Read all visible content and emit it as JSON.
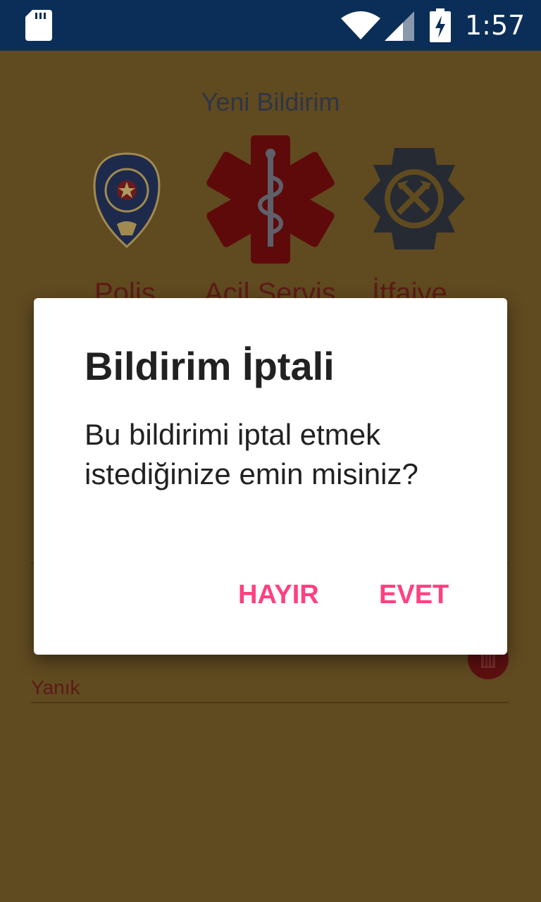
{
  "status_bar": {
    "time": "1:57",
    "icons": [
      "sd-card-icon",
      "wifi-icon",
      "signal-icon",
      "battery-charging-icon"
    ]
  },
  "screen": {
    "title": "Yeni Bildirim",
    "services": [
      {
        "label": "Polis",
        "icon": "police-badge-icon"
      },
      {
        "label": "Acil Servis",
        "icon": "star-of-life-icon"
      },
      {
        "label": "İtfaiye",
        "icon": "fire-department-icon"
      }
    ],
    "visible_field_text": "Yanık"
  },
  "dialog": {
    "title": "Bildirim İptali",
    "message": "Bu bildirimi iptal etmek istediğinize emin misiniz?",
    "negative_button": "HAYIR",
    "positive_button": "EVET"
  },
  "colors": {
    "status_bar": "#0a2e57",
    "dim_background": "#604a20",
    "dialog_button": "#ff4081",
    "ambulance_red": "#5e0a0a",
    "fire_dark": "#252a33"
  }
}
